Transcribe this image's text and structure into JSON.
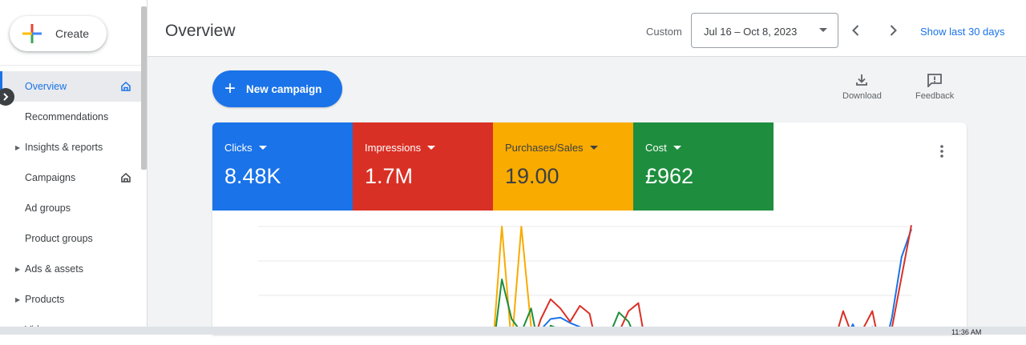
{
  "sidebar": {
    "create_label": "Create",
    "items": [
      {
        "label": "Overview",
        "active": true,
        "caret": false,
        "home": true
      },
      {
        "label": "Recommendations",
        "active": false,
        "caret": false,
        "home": false
      },
      {
        "label": "Insights & reports",
        "active": false,
        "caret": true,
        "home": false
      },
      {
        "label": "Campaigns",
        "active": false,
        "caret": false,
        "home": true
      },
      {
        "label": "Ad groups",
        "active": false,
        "caret": false,
        "home": false
      },
      {
        "label": "Product groups",
        "active": false,
        "caret": false,
        "home": false
      },
      {
        "label": "Ads & assets",
        "active": false,
        "caret": true,
        "home": false
      },
      {
        "label": "Products",
        "active": false,
        "caret": true,
        "home": false
      },
      {
        "label": "Videos",
        "active": false,
        "caret": true,
        "home": false
      }
    ]
  },
  "header": {
    "title": "Overview",
    "custom_label": "Custom",
    "date_range": "Jul 16 – Oct 8, 2023",
    "show_last": "Show last 30 days"
  },
  "main": {
    "new_campaign_label": "New campaign",
    "download_label": "Download",
    "feedback_label": "Feedback",
    "metrics": [
      {
        "name": "Clicks",
        "value": "8.48K",
        "bg": "#1a73e8",
        "fg": "#ffffff"
      },
      {
        "name": "Impressions",
        "value": "1.7M",
        "bg": "#d93025",
        "fg": "#ffffff"
      },
      {
        "name": "Purchases/Sales",
        "value": "19.00",
        "bg": "#f9ab00",
        "fg": "#3c4043"
      },
      {
        "name": "Cost",
        "value": "£962",
        "bg": "#1e8e3e",
        "fg": "#ffffff"
      }
    ]
  },
  "chart_data": {
    "type": "line",
    "title": "",
    "xlabel": "",
    "ylabel": "",
    "grid": true,
    "ylim": [
      0,
      100
    ],
    "series": [
      {
        "color": "#1a73e8",
        "values": [
          0,
          0,
          0,
          0,
          0,
          0,
          0,
          0,
          0,
          0,
          0,
          0,
          0,
          0,
          0,
          0,
          0,
          0,
          0,
          0,
          0,
          0,
          3,
          2,
          0,
          5,
          4,
          10,
          4,
          22,
          30,
          31,
          27,
          24,
          20,
          0,
          10,
          11,
          17,
          9,
          0,
          5,
          0,
          3,
          0,
          5,
          4,
          12,
          0,
          0,
          6,
          0,
          0,
          8,
          0,
          4,
          5,
          3,
          0,
          5,
          12,
          26,
          9,
          24,
          0,
          31,
          77,
          98
        ]
      },
      {
        "color": "#d93025",
        "values": [
          0,
          0,
          0,
          0,
          0,
          0,
          0,
          0,
          0,
          0,
          0,
          0,
          0,
          0,
          0,
          0,
          0,
          0,
          0,
          0,
          0,
          0,
          5,
          0,
          5,
          10,
          3,
          13,
          8,
          30,
          45,
          38,
          28,
          40,
          34,
          0,
          6,
          20,
          36,
          42,
          0,
          0,
          18,
          7,
          0,
          10,
          20,
          8,
          0,
          13,
          9,
          0,
          10,
          10,
          0,
          4,
          0,
          13,
          0,
          10,
          36,
          16,
          22,
          36,
          0,
          23,
          62,
          101
        ]
      },
      {
        "color": "#f9ab00",
        "values": [
          0,
          0,
          0,
          0,
          0,
          0,
          0,
          0,
          0,
          0,
          0,
          0,
          0,
          0,
          0,
          0,
          0,
          0,
          0,
          0,
          0,
          0,
          4,
          2,
          0,
          100,
          10,
          100,
          24,
          14,
          0,
          0,
          0,
          0,
          0,
          0,
          0,
          0,
          0,
          0,
          0,
          0,
          0,
          0,
          0,
          0,
          0,
          0,
          0,
          0,
          0,
          0,
          0,
          0,
          0,
          0,
          0,
          0,
          0,
          0,
          0,
          0,
          0,
          0,
          0,
          0,
          0,
          0
        ]
      },
      {
        "color": "#1e8e3e",
        "values": [
          0,
          0,
          0,
          0,
          0,
          0,
          0,
          0,
          0,
          0,
          0,
          0,
          0,
          0,
          0,
          0,
          0,
          0,
          0,
          0,
          0,
          0,
          5,
          2,
          0,
          60,
          30,
          20,
          38,
          0,
          25,
          22,
          22,
          12,
          20,
          0,
          17,
          35,
          28,
          10,
          0,
          0,
          8,
          0,
          0,
          0,
          0,
          0,
          0,
          0,
          4,
          0,
          0,
          0,
          0,
          0,
          0,
          0,
          0,
          0,
          0,
          0,
          0,
          0,
          0,
          0,
          2,
          8
        ]
      }
    ]
  },
  "taskbar": {
    "clock": "11:36 AM"
  }
}
